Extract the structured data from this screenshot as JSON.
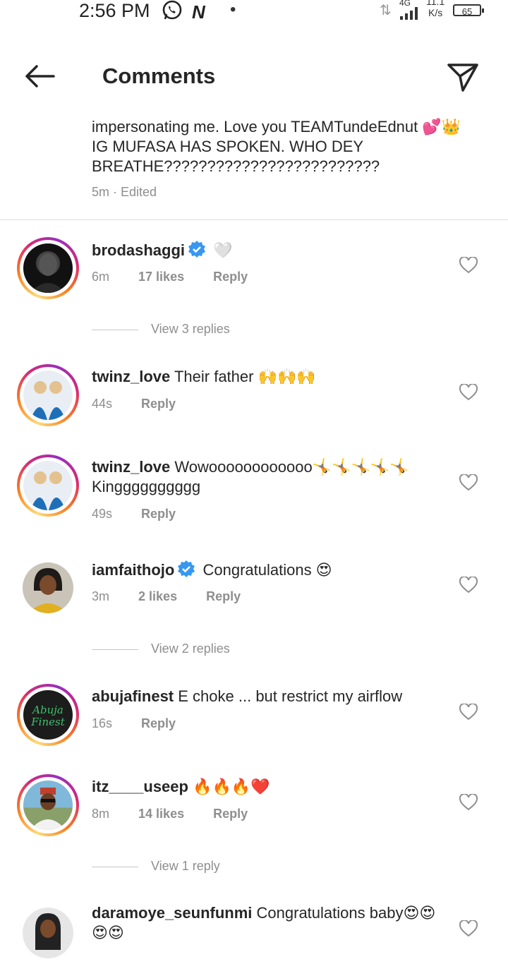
{
  "status_bar": {
    "time": "2:56 PM",
    "network": "4G",
    "speed_value": "11.1",
    "speed_unit": "K/s",
    "battery": "65"
  },
  "header": {
    "title": "Comments"
  },
  "caption": {
    "text": "impersonating me. Love you TEAMTundeEdnut 💕👑 IG MUFASA HAS SPOKEN. WHO DEY BREATHE?????????????????????????",
    "time": "5m",
    "edited": "Edited"
  },
  "comments": [
    {
      "username": "brodashaggi",
      "text": "🤍",
      "time": "6m",
      "likes": "17 likes",
      "reply": "Reply",
      "view_replies": "View 3 replies"
    },
    {
      "username": "twinz_love",
      "text": "Their father 🙌🙌🙌",
      "time": "44s",
      "reply": "Reply"
    },
    {
      "username": "twinz_love",
      "text": "Wowoooooooooooo🤸🤸🤸🤸🤸Kingggggggggg",
      "time": "49s",
      "reply": "Reply"
    },
    {
      "username": "iamfaithojo",
      "text": "Congratulations 😍",
      "time": "3m",
      "likes": "2 likes",
      "reply": "Reply",
      "view_replies": "View 2 replies"
    },
    {
      "username": "abujafinest",
      "text": "E choke ... but restrict my airflow",
      "time": "16s",
      "reply": "Reply"
    },
    {
      "username": "itz____useep",
      "text": "🔥🔥🔥❤️",
      "time": "8m",
      "likes": "14 likes",
      "reply": "Reply",
      "view_replies": "View 1 reply"
    },
    {
      "username": "daramoye_seunfunmi",
      "text": "Congratulations baby😍😍😍😍"
    }
  ],
  "avatar_labels": {
    "abujafinest": "Abuja Finest"
  },
  "colors": {
    "verified": "#3897f0",
    "meta": "#8e8e8e",
    "text": "#262626"
  }
}
